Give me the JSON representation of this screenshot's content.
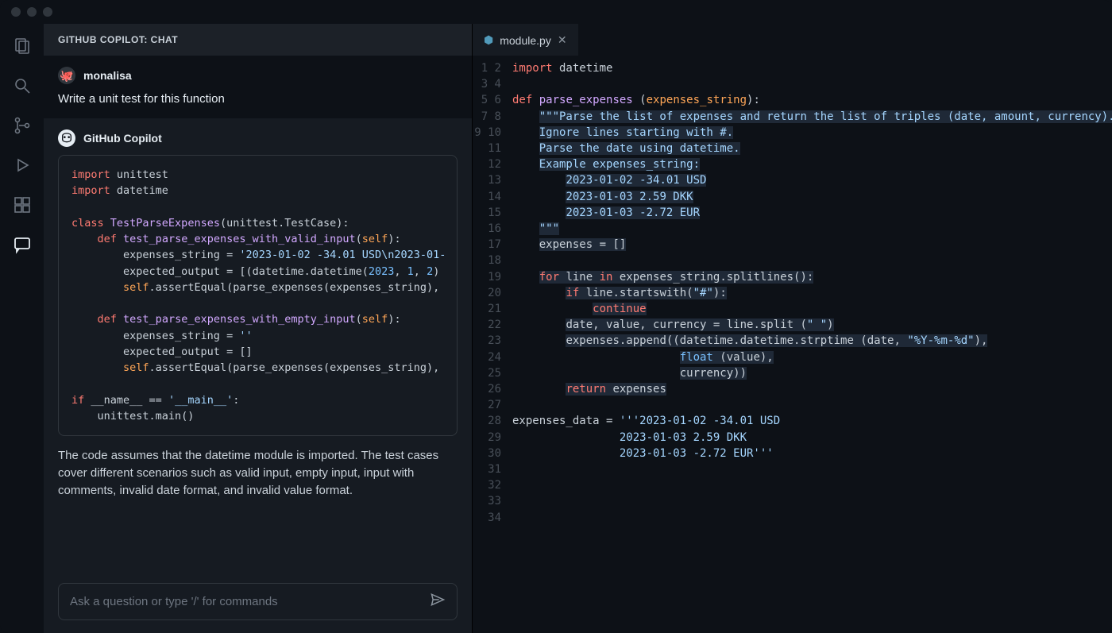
{
  "chat": {
    "panel_title": "GITHUB COPILOT: CHAT",
    "user": {
      "name": "monalisa",
      "prompt": "Write a unit test for this function"
    },
    "bot": {
      "name": "GitHub Copilot",
      "code_lines": [
        [
          [
            "kw",
            "import"
          ],
          [
            "txt",
            " unittest"
          ]
        ],
        [
          [
            "kw",
            "import"
          ],
          [
            "txt",
            " datetime"
          ]
        ],
        [
          [
            "txt",
            ""
          ]
        ],
        [
          [
            "kw",
            "class"
          ],
          [
            "txt",
            " "
          ],
          [
            "fn",
            "TestParseExpenses"
          ],
          [
            "txt",
            "(unittest.TestCase):"
          ]
        ],
        [
          [
            "txt",
            "    "
          ],
          [
            "kw",
            "def"
          ],
          [
            "txt",
            " "
          ],
          [
            "fn",
            "test_parse_expenses_with_valid_input"
          ],
          [
            "txt",
            "("
          ],
          [
            "param",
            "self"
          ],
          [
            "txt",
            "):"
          ]
        ],
        [
          [
            "txt",
            "        expenses_string = "
          ],
          [
            "str",
            "'2023-01-02 -34.01 USD\\n2023-01-"
          ]
        ],
        [
          [
            "txt",
            "        expected_output = [(datetime.datetime("
          ],
          [
            "num",
            "2023"
          ],
          [
            "txt",
            ", "
          ],
          [
            "num",
            "1"
          ],
          [
            "txt",
            ", "
          ],
          [
            "num",
            "2"
          ],
          [
            "txt",
            ")"
          ]
        ],
        [
          [
            "txt",
            "        "
          ],
          [
            "param",
            "self"
          ],
          [
            "txt",
            ".assertEqual(parse_expenses(expenses_string),"
          ]
        ],
        [
          [
            "txt",
            ""
          ]
        ],
        [
          [
            "txt",
            "    "
          ],
          [
            "kw",
            "def"
          ],
          [
            "txt",
            " "
          ],
          [
            "fn",
            "test_parse_expenses_with_empty_input"
          ],
          [
            "txt",
            "("
          ],
          [
            "param",
            "self"
          ],
          [
            "txt",
            "):"
          ]
        ],
        [
          [
            "txt",
            "        expenses_string = "
          ],
          [
            "str",
            "''"
          ]
        ],
        [
          [
            "txt",
            "        expected_output = []"
          ]
        ],
        [
          [
            "txt",
            "        "
          ],
          [
            "param",
            "self"
          ],
          [
            "txt",
            ".assertEqual(parse_expenses(expenses_string),"
          ]
        ],
        [
          [
            "txt",
            ""
          ]
        ],
        [
          [
            "kw",
            "if"
          ],
          [
            "txt",
            " __name__ == "
          ],
          [
            "str",
            "'__main__'"
          ],
          [
            "txt",
            ":"
          ]
        ],
        [
          [
            "txt",
            "    unittest.main()"
          ]
        ]
      ],
      "reply": "The code assumes that the datetime module is imported. The test cases cover different scenarios such as valid input, empty input, input with comments, invalid date format, and invalid value format."
    },
    "input_placeholder": "Ask a question or type '/' for commands"
  },
  "editor": {
    "tab_name": "module.py",
    "total_lines": 34,
    "code_lines": [
      [
        [
          "kw",
          "import"
        ],
        [
          "txt",
          " datetime"
        ]
      ],
      [
        [
          "txt",
          ""
        ]
      ],
      [
        [
          "kw",
          "def"
        ],
        [
          "txt",
          " "
        ],
        [
          "fn",
          "parse_expenses"
        ],
        [
          "txt",
          " ("
        ],
        [
          "param",
          "expenses_string"
        ],
        [
          "txt",
          "):"
        ]
      ],
      [
        [
          "txt",
          "    "
        ],
        [
          "sel",
          [
            [
              "str",
              "\"\"\"Parse the list of expenses and return the list of triples (date, amount, currency)."
            ]
          ]
        ]
      ],
      [
        [
          "txt",
          "    "
        ],
        [
          "sel",
          [
            [
              "str",
              "Ignore lines starting with #."
            ]
          ]
        ]
      ],
      [
        [
          "txt",
          "    "
        ],
        [
          "sel",
          [
            [
              "str",
              "Parse the date using datetime."
            ]
          ]
        ]
      ],
      [
        [
          "txt",
          "    "
        ],
        [
          "sel",
          [
            [
              "str",
              "Example expenses_string:"
            ]
          ]
        ]
      ],
      [
        [
          "txt",
          "        "
        ],
        [
          "sel",
          [
            [
              "str",
              "2023-01-02 -34.01 USD"
            ]
          ]
        ]
      ],
      [
        [
          "txt",
          "        "
        ],
        [
          "sel",
          [
            [
              "str",
              "2023-01-03 2.59 DKK"
            ]
          ]
        ]
      ],
      [
        [
          "txt",
          "        "
        ],
        [
          "sel",
          [
            [
              "str",
              "2023-01-03 -2.72 EUR"
            ]
          ]
        ]
      ],
      [
        [
          "txt",
          "    "
        ],
        [
          "sel",
          [
            [
              "str",
              "\"\"\""
            ]
          ]
        ]
      ],
      [
        [
          "txt",
          "    "
        ],
        [
          "sel",
          [
            [
              "txt",
              "expenses = []"
            ]
          ]
        ]
      ],
      [
        [
          "sel",
          [
            [
              "txt",
              ""
            ]
          ]
        ]
      ],
      [
        [
          "txt",
          "    "
        ],
        [
          "sel",
          [
            [
              "kw",
              "for"
            ],
            [
              "txt",
              " line "
            ],
            [
              "kw",
              "in"
            ],
            [
              "txt",
              " expenses_string.splitlines():"
            ]
          ]
        ]
      ],
      [
        [
          "txt",
          "        "
        ],
        [
          "sel",
          [
            [
              "kw",
              "if"
            ],
            [
              "txt",
              " line.startswith("
            ],
            [
              "str",
              "\"#\""
            ],
            [
              "txt",
              "):"
            ]
          ]
        ]
      ],
      [
        [
          "txt",
          "            "
        ],
        [
          "sel",
          [
            [
              "kw",
              "continue"
            ]
          ]
        ]
      ],
      [
        [
          "txt",
          "        "
        ],
        [
          "sel",
          [
            [
              "txt",
              "date, value, currency = line.split ("
            ],
            [
              "str",
              "\" \""
            ],
            [
              "txt",
              ")"
            ]
          ]
        ]
      ],
      [
        [
          "txt",
          "        "
        ],
        [
          "sel",
          [
            [
              "txt",
              "expenses.append((datetime.datetime.strptime (date, "
            ],
            [
              "str",
              "\"%Y-%m-%d\""
            ],
            [
              "txt",
              "),"
            ]
          ]
        ]
      ],
      [
        [
          "txt",
          "                         "
        ],
        [
          "sel",
          [
            [
              "builtin",
              "float"
            ],
            [
              "txt",
              " (value),"
            ]
          ]
        ]
      ],
      [
        [
          "txt",
          "                         "
        ],
        [
          "sel",
          [
            [
              "txt",
              "currency))"
            ]
          ]
        ]
      ],
      [
        [
          "txt",
          "        "
        ],
        [
          "sel",
          [
            [
              "kw",
              "return"
            ],
            [
              "txt",
              " expenses"
            ]
          ]
        ]
      ],
      [
        [
          "txt",
          ""
        ]
      ],
      [
        [
          "txt",
          "expenses_data = "
        ],
        [
          "str",
          "'''2023-01-02 -34.01 USD"
        ]
      ],
      [
        [
          "txt",
          "                "
        ],
        [
          "str",
          "2023-01-03 2.59 DKK"
        ]
      ],
      [
        [
          "txt",
          "                "
        ],
        [
          "str",
          "2023-01-03 -2.72 EUR'''"
        ]
      ]
    ]
  }
}
